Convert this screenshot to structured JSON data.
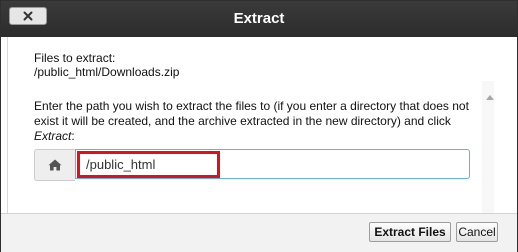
{
  "dialog": {
    "title": "Extract",
    "close_icon": "close-icon"
  },
  "content": {
    "files_label": "Files to extract:",
    "files_path": "/public_html/Downloads.zip",
    "instructions_prefix": "Enter the path you wish to extract the files to (if you enter a directory that does not exist it will be created, and the archive extracted in the new directory) and click ",
    "instructions_action": "Extract",
    "instructions_suffix": ":",
    "home_icon": "home-icon"
  },
  "path_input": {
    "value": "/public_html"
  },
  "highlight": {
    "color": "#e0101a"
  },
  "footer": {
    "extract_label": "Extract Files",
    "cancel_label": "Cancel"
  }
}
